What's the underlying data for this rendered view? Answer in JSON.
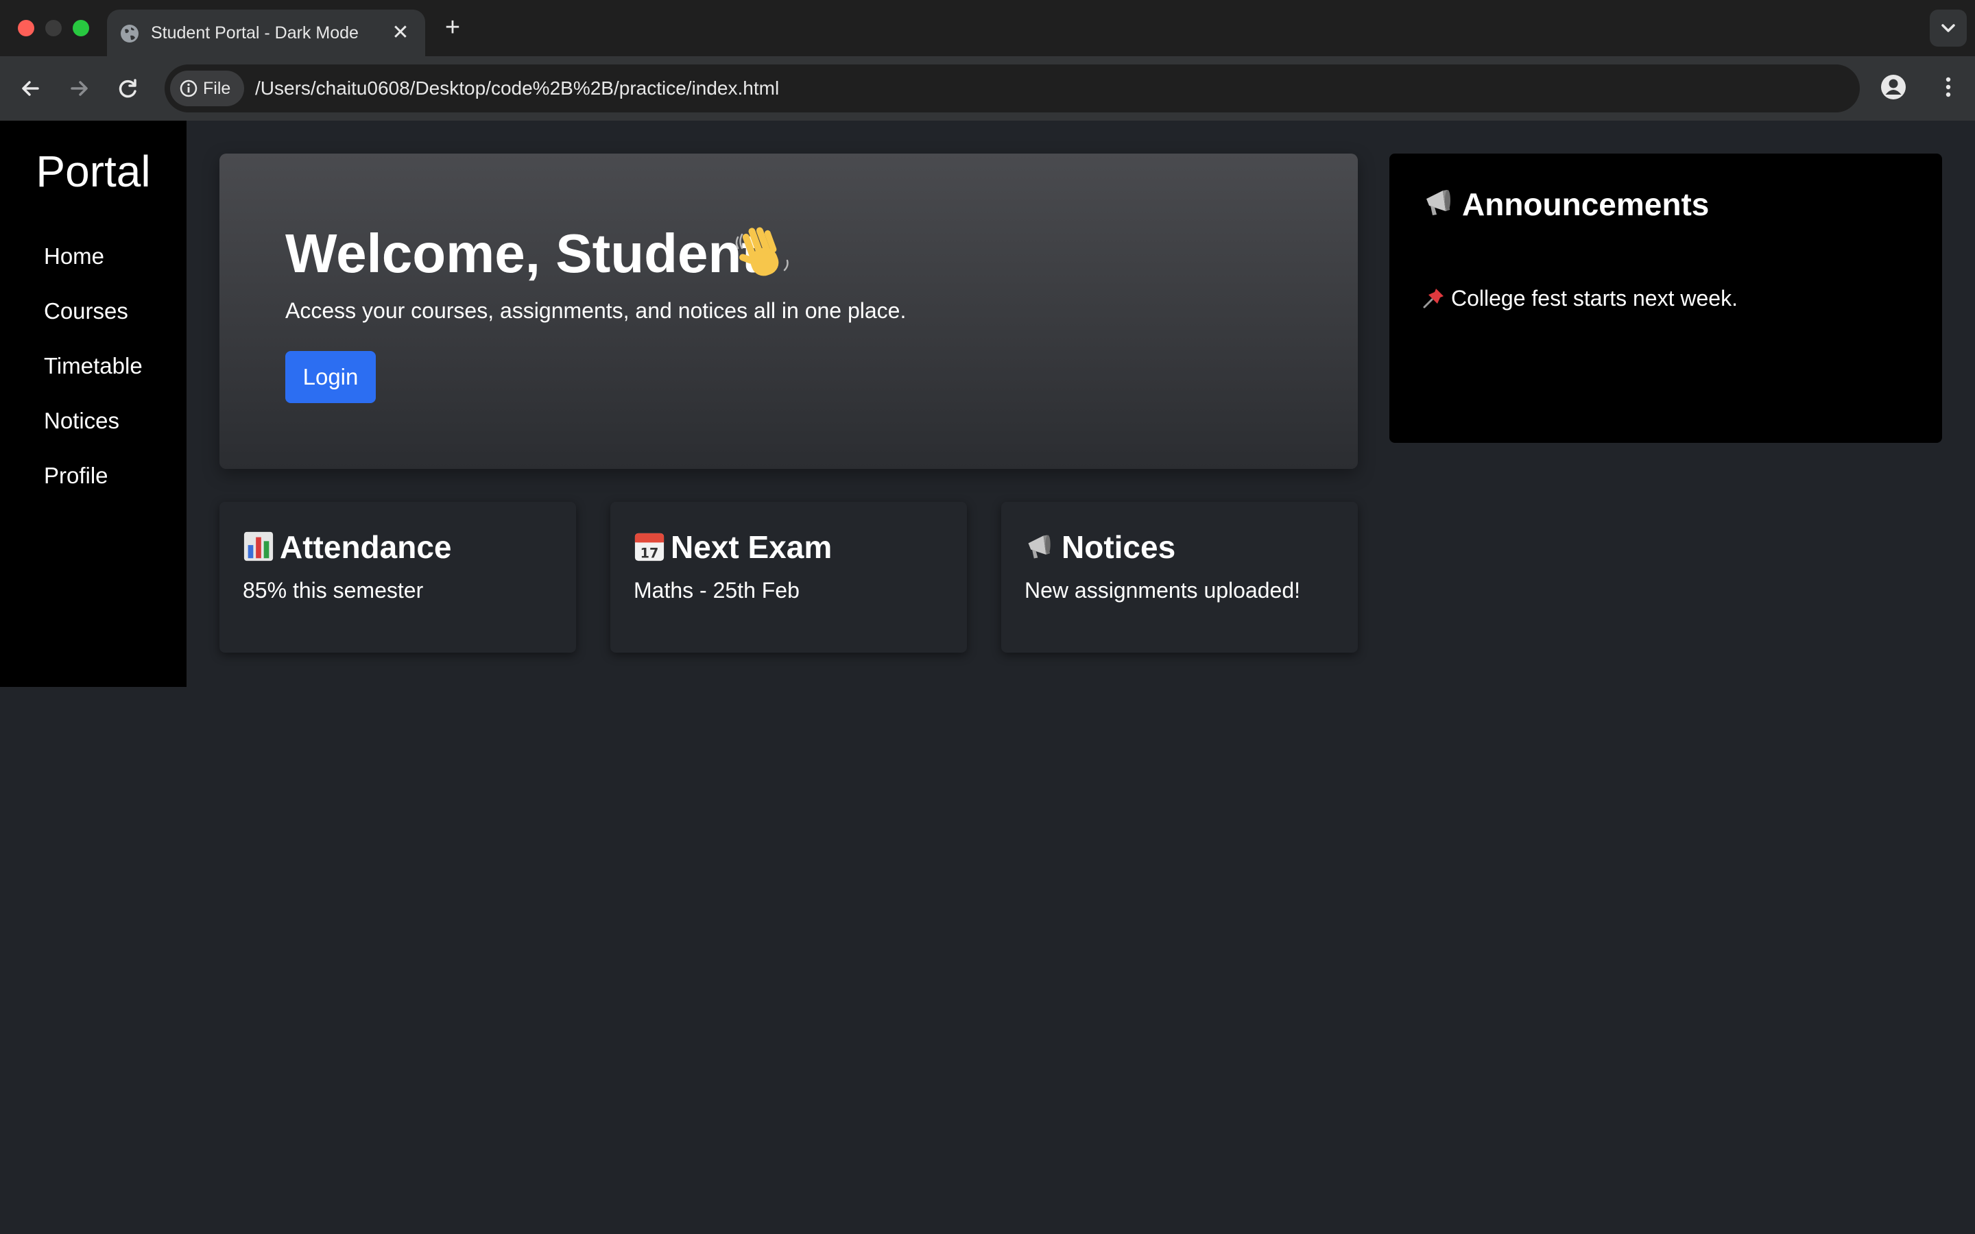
{
  "browser": {
    "tab_title": "Student Portal - Dark Mode",
    "new_tab_label": "+",
    "close_label": "✕",
    "url_scheme_label": "File",
    "url": "/Users/chaitu0608/Desktop/code%2B%2B/practice/index.html"
  },
  "sidebar": {
    "brand": "Portal",
    "items": [
      {
        "label": "Home"
      },
      {
        "label": "Courses"
      },
      {
        "label": "Timetable"
      },
      {
        "label": "Notices"
      },
      {
        "label": "Profile"
      }
    ]
  },
  "hero": {
    "title": "Welcome, Student",
    "subtitle": "Access your courses, assignments, and notices all in one place.",
    "login_label": "Login",
    "icon": "waving-hand-icon"
  },
  "announcements": {
    "title": "Announcements",
    "icon": "megaphone-icon",
    "items": [
      {
        "icon": "pushpin-icon",
        "text": "College fest starts next week."
      }
    ]
  },
  "cards": [
    {
      "icon": "bar-chart-icon",
      "title": "Attendance",
      "text": "85% this semester"
    },
    {
      "icon": "calendar-icon",
      "title": "Next Exam",
      "text": "Maths - 25th Feb"
    },
    {
      "icon": "megaphone-icon",
      "title": "Notices",
      "text": "New assignments uploaded!"
    }
  ],
  "colors": {
    "page_bg": "#212429",
    "sidebar_bg": "#000000",
    "accent": "#2c6ef2",
    "card_bg": "#23262b"
  }
}
